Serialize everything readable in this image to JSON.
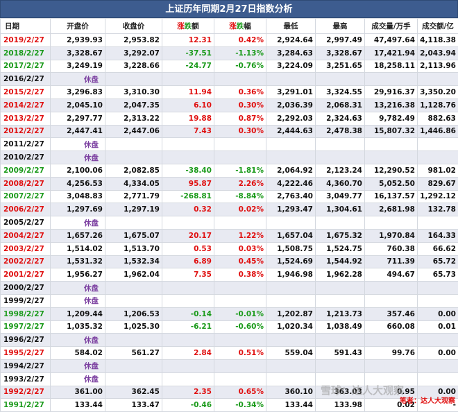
{
  "title": "上证历年同期2月27日指数分析",
  "header": {
    "date": "日期",
    "open": "开盘价",
    "close": "收盘价",
    "chg_a": "涨",
    "chg_b": "跌",
    "chg_c": "额",
    "pct_a": "涨",
    "pct_b": "跌",
    "pct_c": "幅",
    "low": "最低",
    "high": "最高",
    "vol": "成交量/万手",
    "amt": "成交额/亿"
  },
  "rows": [
    {
      "date": "2019/2/27",
      "open": "2,939.93",
      "close": "2,953.82",
      "chg": "12.31",
      "pct": "0.42%",
      "low": "2,924.64",
      "high": "2,997.49",
      "vol": "47,497.64",
      "amt": "4,118.38",
      "dir": "up"
    },
    {
      "date": "2018/2/27",
      "open": "3,328.67",
      "close": "3,292.07",
      "chg": "-37.51",
      "pct": "-1.13%",
      "low": "3,284.63",
      "high": "3,328.67",
      "vol": "17,421.94",
      "amt": "2,043.94",
      "dir": "down"
    },
    {
      "date": "2017/2/27",
      "open": "3,249.19",
      "close": "3,228.66",
      "chg": "-24.77",
      "pct": "-0.76%",
      "low": "3,224.09",
      "high": "3,251.65",
      "vol": "18,258.11",
      "amt": "2,113.96",
      "dir": "down"
    },
    {
      "date": "2016/2/27",
      "halt": "休盘",
      "dir": "halt"
    },
    {
      "date": "2015/2/27",
      "open": "3,296.83",
      "close": "3,310.30",
      "chg": "11.94",
      "pct": "0.36%",
      "low": "3,291.01",
      "high": "3,324.55",
      "vol": "29,916.37",
      "amt": "3,350.20",
      "dir": "up"
    },
    {
      "date": "2014/2/27",
      "open": "2,045.10",
      "close": "2,047.35",
      "chg": "6.10",
      "pct": "0.30%",
      "low": "2,036.39",
      "high": "2,068.31",
      "vol": "13,216.38",
      "amt": "1,128.76",
      "dir": "up"
    },
    {
      "date": "2013/2/27",
      "open": "2,297.77",
      "close": "2,313.22",
      "chg": "19.88",
      "pct": "0.87%",
      "low": "2,292.03",
      "high": "2,324.63",
      "vol": "9,782.49",
      "amt": "882.63",
      "dir": "up"
    },
    {
      "date": "2012/2/27",
      "open": "2,447.41",
      "close": "2,447.06",
      "chg": "7.43",
      "pct": "0.30%",
      "low": "2,444.63",
      "high": "2,478.38",
      "vol": "15,807.32",
      "amt": "1,446.86",
      "dir": "up"
    },
    {
      "date": "2011/2/27",
      "halt": "休盘",
      "dir": "halt"
    },
    {
      "date": "2010/2/27",
      "halt": "休盘",
      "dir": "halt"
    },
    {
      "date": "2009/2/27",
      "open": "2,100.06",
      "close": "2,082.85",
      "chg": "-38.40",
      "pct": "-1.81%",
      "low": "2,064.92",
      "high": "2,123.24",
      "vol": "12,290.52",
      "amt": "981.02",
      "dir": "down"
    },
    {
      "date": "2008/2/27",
      "open": "4,256.53",
      "close": "4,334.05",
      "chg": "95.87",
      "pct": "2.26%",
      "low": "4,222.46",
      "high": "4,360.70",
      "vol": "5,052.50",
      "amt": "829.67",
      "dir": "up"
    },
    {
      "date": "2007/2/27",
      "open": "3,048.83",
      "close": "2,771.79",
      "chg": "-268.81",
      "pct": "-8.84%",
      "low": "2,763.40",
      "high": "3,049.77",
      "vol": "16,137.57",
      "amt": "1,292.12",
      "dir": "down"
    },
    {
      "date": "2006/2/27",
      "open": "1,297.69",
      "close": "1,297.19",
      "chg": "0.32",
      "pct": "0.02%",
      "low": "1,293.47",
      "high": "1,304.61",
      "vol": "2,681.98",
      "amt": "132.78",
      "dir": "up"
    },
    {
      "date": "2005/2/27",
      "halt": "休盘",
      "dir": "halt"
    },
    {
      "date": "2004/2/27",
      "open": "1,657.26",
      "close": "1,675.07",
      "chg": "20.17",
      "pct": "1.22%",
      "low": "1,657.04",
      "high": "1,675.32",
      "vol": "1,970.84",
      "amt": "164.33",
      "dir": "up"
    },
    {
      "date": "2003/2/27",
      "open": "1,514.02",
      "close": "1,513.70",
      "chg": "0.53",
      "pct": "0.03%",
      "low": "1,508.75",
      "high": "1,524.75",
      "vol": "760.38",
      "amt": "66.62",
      "dir": "up"
    },
    {
      "date": "2002/2/27",
      "open": "1,531.32",
      "close": "1,532.34",
      "chg": "6.89",
      "pct": "0.45%",
      "low": "1,524.69",
      "high": "1,544.92",
      "vol": "711.39",
      "amt": "65.72",
      "dir": "up"
    },
    {
      "date": "2001/2/27",
      "open": "1,956.27",
      "close": "1,962.04",
      "chg": "7.35",
      "pct": "0.38%",
      "low": "1,946.98",
      "high": "1,962.28",
      "vol": "494.67",
      "amt": "65.73",
      "dir": "up"
    },
    {
      "date": "2000/2/27",
      "halt": "休盘",
      "dir": "halt"
    },
    {
      "date": "1999/2/27",
      "halt": "休盘",
      "dir": "halt"
    },
    {
      "date": "1998/2/27",
      "open": "1,209.44",
      "close": "1,206.53",
      "chg": "-0.14",
      "pct": "-0.01%",
      "low": "1,202.87",
      "high": "1,213.73",
      "vol": "357.46",
      "amt": "0.00",
      "dir": "down"
    },
    {
      "date": "1997/2/27",
      "open": "1,035.32",
      "close": "1,025.30",
      "chg": "-6.21",
      "pct": "-0.60%",
      "low": "1,020.34",
      "high": "1,038.49",
      "vol": "660.08",
      "amt": "0.01",
      "dir": "down"
    },
    {
      "date": "1996/2/27",
      "halt": "休盘",
      "dir": "halt"
    },
    {
      "date": "1995/2/27",
      "open": "584.02",
      "close": "561.27",
      "chg": "2.84",
      "pct": "0.51%",
      "low": "559.04",
      "high": "591.43",
      "vol": "99.76",
      "amt": "0.00",
      "dir": "up"
    },
    {
      "date": "1994/2/27",
      "halt": "休盘",
      "dir": "halt"
    },
    {
      "date": "1993/2/27",
      "halt": "休盘",
      "dir": "halt"
    },
    {
      "date": "1992/2/27",
      "open": "361.00",
      "close": "362.45",
      "chg": "2.35",
      "pct": "0.65%",
      "low": "360.10",
      "high": "363.03",
      "vol": "0.95",
      "amt": "0.00",
      "dir": "up"
    },
    {
      "date": "1991/2/27",
      "open": "133.44",
      "close": "133.47",
      "chg": "-0.46",
      "pct": "-0.34%",
      "low": "133.44",
      "high": "133.98",
      "vol": "0.02",
      "amt": "-",
      "dir": "down"
    }
  ],
  "watermark": "雪球：达人大观察",
  "author": "笔者：达人大观察"
}
